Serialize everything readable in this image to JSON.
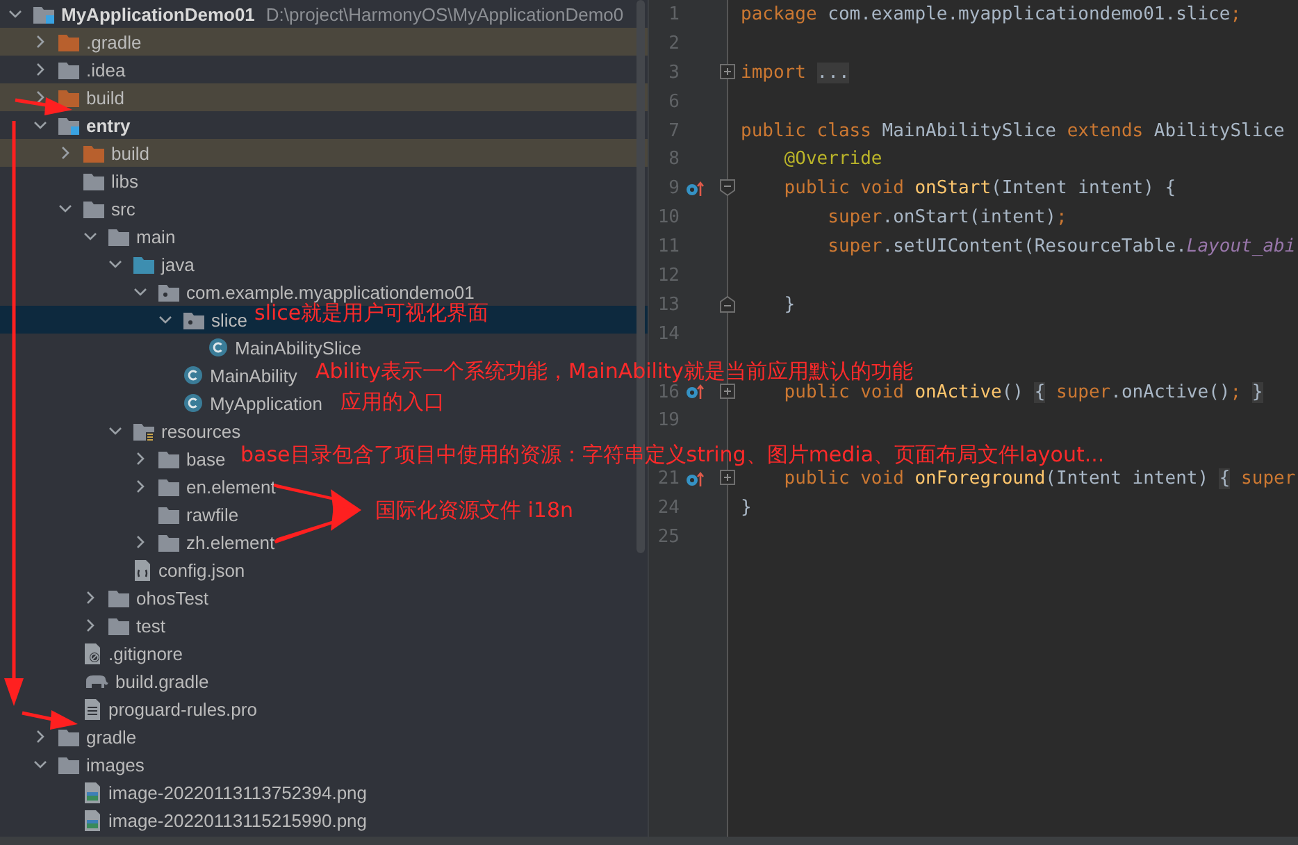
{
  "project_tree": {
    "label": "MyApplicationDemo01",
    "path": "D:\\project\\HarmonyOS\\MyApplicationDemo0",
    "kind": "module",
    "expanded": true,
    "selected": false,
    "children": [
      {
        "label": ".gradle",
        "kind": "excluded-folder",
        "expanded": false,
        "selected": false
      },
      {
        "label": ".idea",
        "kind": "folder",
        "expanded": false,
        "selected": false
      },
      {
        "label": "build",
        "kind": "excluded-folder",
        "expanded": false,
        "selected": false
      },
      {
        "label": "entry",
        "kind": "module",
        "expanded": true,
        "selected": false,
        "children": [
          {
            "label": "build",
            "kind": "excluded-folder",
            "expanded": false,
            "selected": false
          },
          {
            "label": "libs",
            "kind": "folder",
            "selected": false
          },
          {
            "label": "src",
            "kind": "folder",
            "expanded": true,
            "selected": false,
            "children": [
              {
                "label": "main",
                "kind": "folder",
                "expanded": true,
                "selected": false,
                "children": [
                  {
                    "label": "java",
                    "kind": "source-folder",
                    "expanded": true,
                    "selected": false,
                    "children": [
                      {
                        "label": "com.example.myapplicationdemo01",
                        "kind": "package",
                        "expanded": true,
                        "selected": false,
                        "children": [
                          {
                            "label": "slice",
                            "kind": "package",
                            "expanded": true,
                            "selected": true,
                            "children": [
                              {
                                "label": "MainAbilitySlice",
                                "kind": "class",
                                "selected": false
                              }
                            ]
                          },
                          {
                            "label": "MainAbility",
                            "kind": "class",
                            "selected": false
                          },
                          {
                            "label": "MyApplication",
                            "kind": "class",
                            "selected": false
                          }
                        ]
                      }
                    ]
                  },
                  {
                    "label": "resources",
                    "kind": "resources-folder",
                    "expanded": true,
                    "selected": false,
                    "children": [
                      {
                        "label": "base",
                        "kind": "folder",
                        "expanded": false,
                        "selected": false
                      },
                      {
                        "label": "en.element",
                        "kind": "folder",
                        "expanded": false,
                        "selected": false
                      },
                      {
                        "label": "rawfile",
                        "kind": "folder",
                        "selected": false
                      },
                      {
                        "label": "zh.element",
                        "kind": "folder",
                        "expanded": false,
                        "selected": false
                      }
                    ]
                  },
                  {
                    "label": "config.json",
                    "kind": "json-file",
                    "selected": false
                  }
                ]
              },
              {
                "label": "ohosTest",
                "kind": "folder",
                "expanded": false,
                "selected": false
              },
              {
                "label": "test",
                "kind": "folder",
                "expanded": false,
                "selected": false
              }
            ]
          },
          {
            "label": ".gitignore",
            "kind": "ignore-file",
            "selected": false
          },
          {
            "label": "build.gradle",
            "kind": "gradle-file",
            "selected": false
          },
          {
            "label": "proguard-rules.pro",
            "kind": "text-file",
            "selected": false
          }
        ]
      },
      {
        "label": "gradle",
        "kind": "folder",
        "expanded": false,
        "selected": false
      },
      {
        "label": "images",
        "kind": "folder",
        "expanded": true,
        "selected": false,
        "children": [
          {
            "label": "image-20220113113752394.png",
            "kind": "image-file",
            "selected": false
          },
          {
            "label": "image-20220113115215990.png",
            "kind": "image-file",
            "selected": false
          }
        ]
      }
    ]
  },
  "editor": {
    "lines": [
      {
        "number": "1",
        "kind": "code",
        "override": false,
        "tokens": [
          {
            "text": "package",
            "kind": "keyword"
          },
          {
            "text": " com.example.myapplicationdemo01.slice",
            "kind": "plain"
          },
          {
            "text": ";",
            "kind": "keyword"
          }
        ]
      },
      {
        "number": "2",
        "kind": "code",
        "override": false
      },
      {
        "number": "3",
        "kind": "fold-start",
        "expanded": false,
        "override": false,
        "tokens": [
          {
            "text": "import ",
            "kind": "keyword"
          },
          {
            "text": "...",
            "kind": "folded"
          }
        ]
      },
      {
        "number": "6",
        "kind": "code",
        "override": false
      },
      {
        "number": "7",
        "kind": "code",
        "override": false,
        "tokens": [
          {
            "text": "public class",
            "kind": "keyword"
          },
          {
            "text": " MainAbilitySlice ",
            "kind": "plain"
          },
          {
            "text": "extends",
            "kind": "keyword"
          },
          {
            "text": " AbilitySlice",
            "kind": "plain"
          }
        ]
      },
      {
        "number": "8",
        "kind": "code",
        "override": false,
        "tokens": [
          {
            "text": "    @Override",
            "kind": "annotation"
          }
        ]
      },
      {
        "number": "9",
        "kind": "fold-start",
        "expanded": true,
        "override": true,
        "tokens": [
          {
            "text": "    public void ",
            "kind": "keyword"
          },
          {
            "text": "onStart",
            "kind": "method"
          },
          {
            "text": "(Intent intent) {",
            "kind": "plain"
          }
        ]
      },
      {
        "number": "10",
        "kind": "code",
        "override": false,
        "tokens": [
          {
            "text": "        super",
            "kind": "keyword"
          },
          {
            "text": ".onStart(intent)",
            "kind": "plain"
          },
          {
            "text": ";",
            "kind": "keyword"
          }
        ]
      },
      {
        "number": "11",
        "kind": "code",
        "override": false,
        "tokens": [
          {
            "text": "        super",
            "kind": "keyword"
          },
          {
            "text": ".setUIContent(ResourceTable.",
            "kind": "plain"
          },
          {
            "text": "Layout_abi",
            "kind": "field"
          }
        ]
      },
      {
        "number": "12",
        "kind": "code",
        "override": false
      },
      {
        "number": "13",
        "kind": "fold-end",
        "override": false,
        "tokens": [
          {
            "text": "    }",
            "kind": "plain"
          }
        ]
      },
      {
        "number": "14",
        "kind": "code",
        "override": false
      },
      {
        "kind": "code",
        "override": false
      },
      {
        "number": "16",
        "kind": "fold-start",
        "expanded": false,
        "override": true,
        "tokens": [
          {
            "text": "    public void ",
            "kind": "keyword"
          },
          {
            "text": "onActive",
            "kind": "method"
          },
          {
            "text": "() ",
            "kind": "plain"
          },
          {
            "text": "{",
            "kind": "folded"
          },
          {
            "text": " super",
            "kind": "keyword"
          },
          {
            "text": ".onActive()",
            "kind": "plain"
          },
          {
            "text": "; ",
            "kind": "keyword"
          },
          {
            "text": "}",
            "kind": "folded"
          }
        ]
      },
      {
        "number": "19",
        "kind": "code",
        "override": false
      },
      {
        "kind": "code",
        "override": false
      },
      {
        "number": "21",
        "kind": "fold-start",
        "expanded": false,
        "override": true,
        "tokens": [
          {
            "text": "    public void ",
            "kind": "keyword"
          },
          {
            "text": "onForeground",
            "kind": "method"
          },
          {
            "text": "(Intent intent) ",
            "kind": "plain"
          },
          {
            "text": "{",
            "kind": "folded"
          },
          {
            "text": " super",
            "kind": "keyword"
          }
        ]
      },
      {
        "number": "24",
        "kind": "code",
        "override": false,
        "tokens": [
          {
            "text": "}",
            "kind": "plain"
          }
        ]
      },
      {
        "number": "25",
        "kind": "code",
        "override": false
      }
    ]
  },
  "annotations": [
    {
      "text": "slice就是用户可视化界面"
    },
    {
      "text": "Ability表示一个系统功能，MainAbility就是当前应用默认的功能"
    },
    {
      "text": "应用的入口"
    },
    {
      "text": "base目录包含了项目中使用的资源：字符串定义string、图片media、页面布局文件layout..."
    },
    {
      "text": "国际化资源文件 i18n"
    }
  ]
}
